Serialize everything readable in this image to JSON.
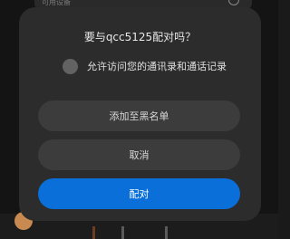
{
  "background": {
    "top_text": "可用设备"
  },
  "dialog": {
    "title": "要与qcc5125配对吗？",
    "checkbox_label": "允许访问您的通讯录和通话记录",
    "checkbox_checked": false,
    "buttons": {
      "block": "添加至黑名单",
      "cancel": "取消",
      "pair": "配对"
    }
  },
  "colors": {
    "dialog_bg": "#2c2c2c",
    "button_bg": "#3c3c3c",
    "primary": "#0a6fd8"
  }
}
